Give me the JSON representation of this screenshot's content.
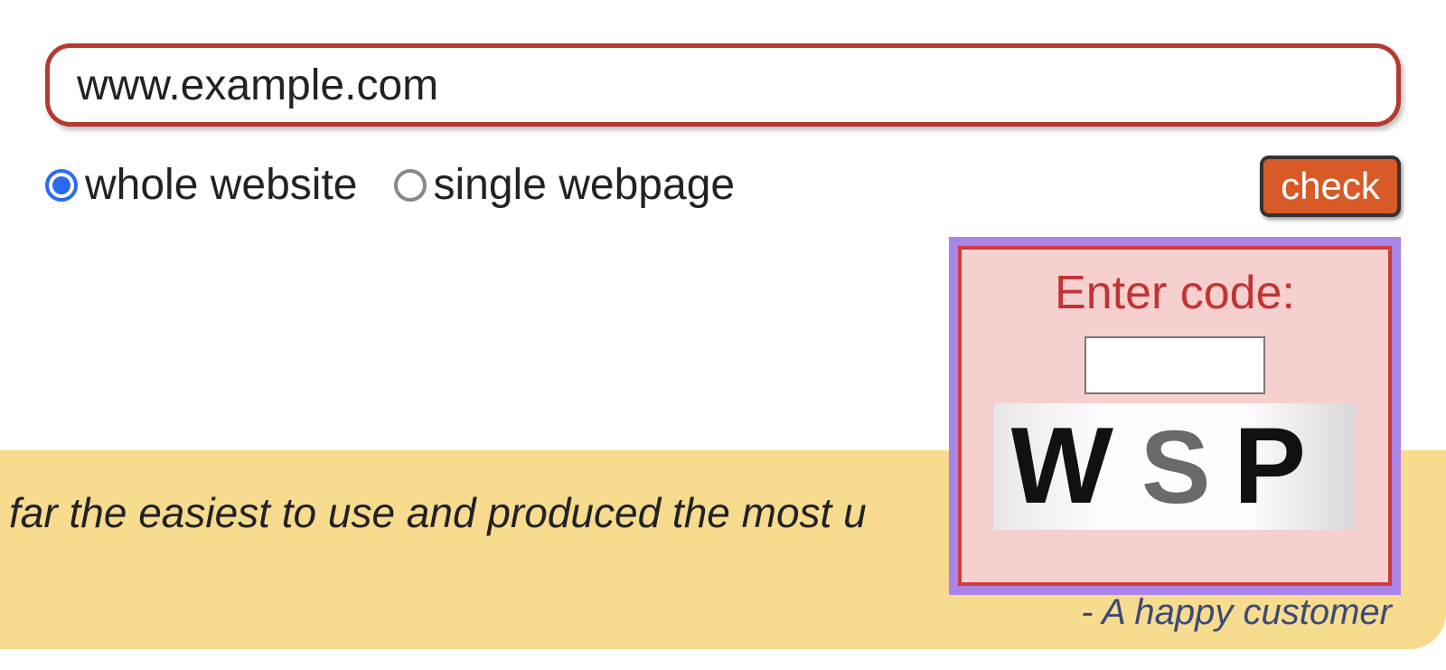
{
  "form": {
    "url_value": "www.example.com",
    "scope_options": {
      "whole_website": "whole website",
      "single_webpage": "single webpage",
      "selected": "whole_website"
    },
    "check_button_label": "check"
  },
  "captcha": {
    "title": "Enter code:",
    "input_value": "",
    "code_text": "WSP"
  },
  "testimonial": {
    "text_fragment": "far the easiest to use and produced the most u",
    "attribution": "- A happy customer"
  },
  "colors": {
    "url_border": "#b43a2f",
    "radio_selected": "#2a6af0",
    "check_button_bg": "#d85a26",
    "testimonial_bg": "#f7db8f",
    "captcha_outer": "#a985e8",
    "captcha_inner_bg": "#f6cfcf",
    "captcha_border": "#d03a3a",
    "captcha_title": "#c23434"
  }
}
